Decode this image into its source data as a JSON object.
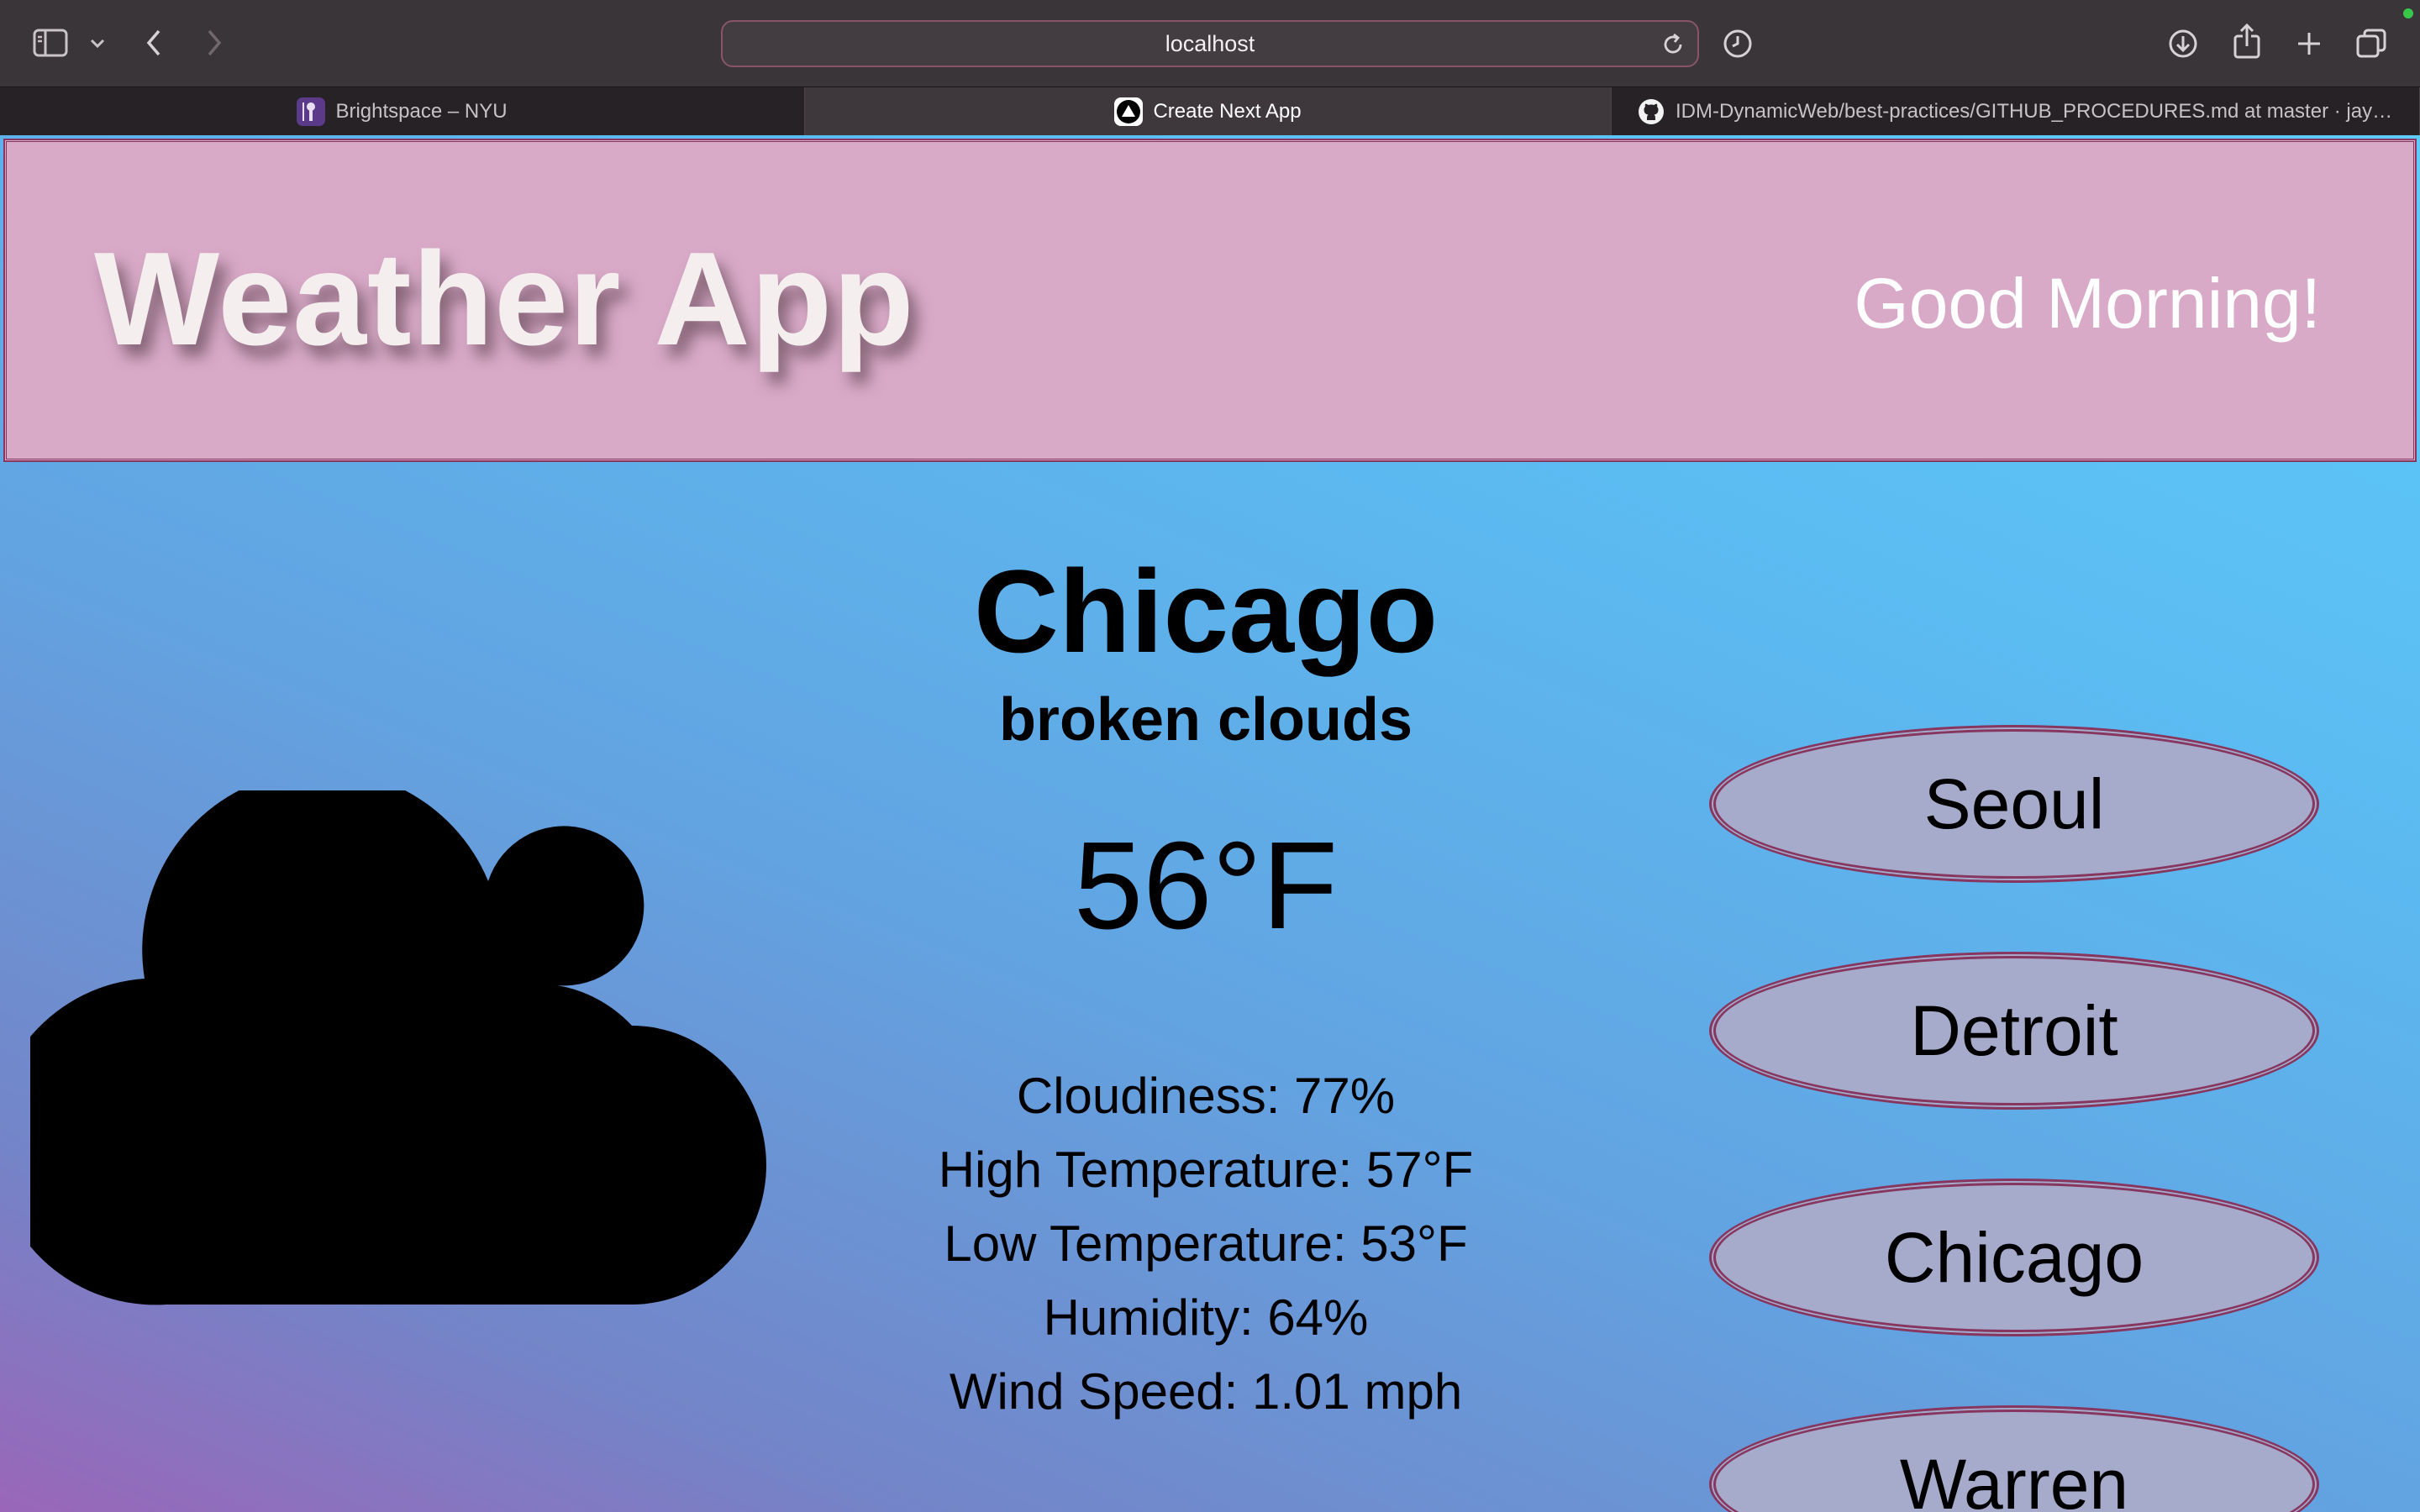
{
  "browser": {
    "url": "localhost",
    "tabs": [
      {
        "label": "Brightspace – NYU",
        "active": false,
        "favicon": "brightspace-favicon"
      },
      {
        "label": "Create Next App",
        "active": true,
        "favicon": "nextjs-favicon"
      },
      {
        "label": "IDM-DynamicWeb/best-practices/GITHUB_PROCEDURES.md at master · jayre…",
        "active": false,
        "favicon": "github-favicon"
      }
    ]
  },
  "header": {
    "title": "Weather App",
    "greeting": "Good Morning!"
  },
  "weather": {
    "city": "Chicago",
    "description": "broken clouds",
    "temperature": "56°F",
    "icon": "cloud-icon",
    "stats": [
      "Cloudiness: 77%",
      "High Temperature: 57°F",
      "Low Temperature: 53°F",
      "Humidity: 64%",
      "Wind Speed: 1.01 mph"
    ]
  },
  "cities": [
    "Seoul",
    "Detroit",
    "Chicago",
    "Warren"
  ],
  "colors": {
    "header_bg": "#d9aac8",
    "border": "#86365f",
    "button_bg": "#a6aacb",
    "gradient_start": "#9a66b9",
    "gradient_end": "#5ecbfa"
  }
}
